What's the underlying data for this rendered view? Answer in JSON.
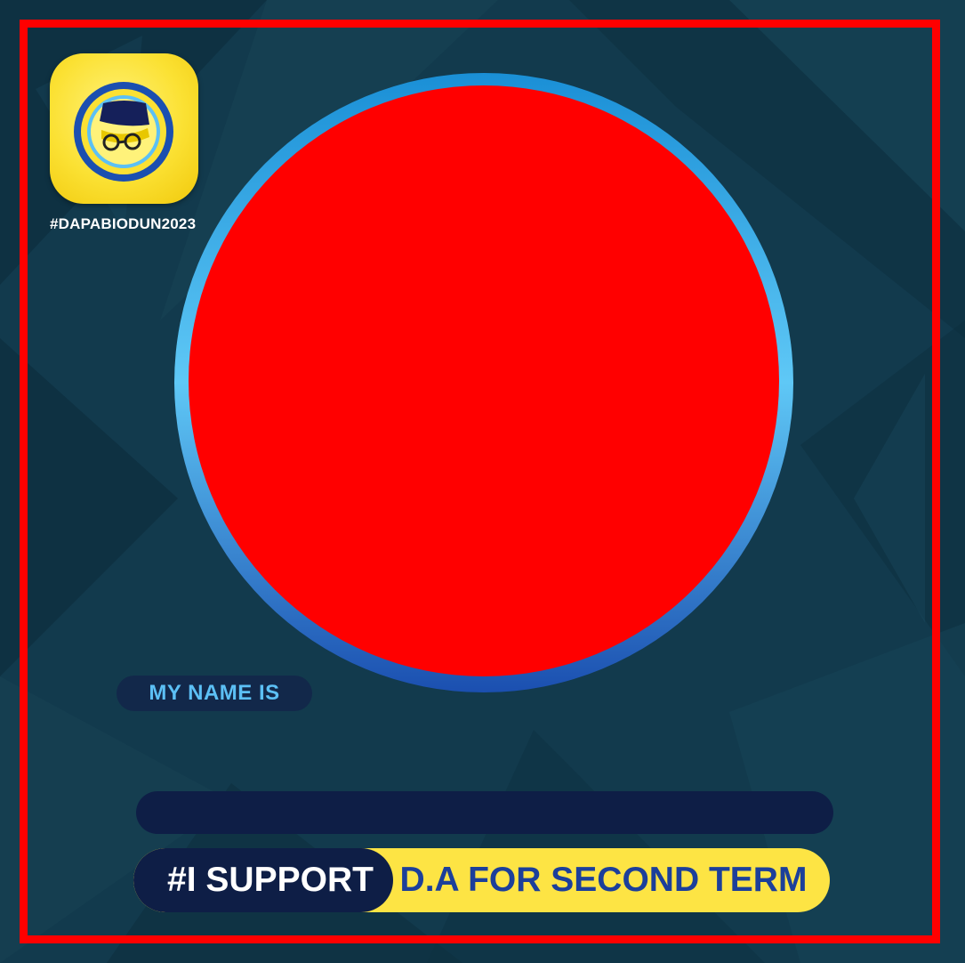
{
  "logo": {
    "hashtag": "#DAPABIODUN2023"
  },
  "name_section": {
    "label": "MY NAME IS",
    "value": ""
  },
  "support_bar": {
    "prefix": "#I SUPPORT",
    "message": "D.A FOR SECOND TERM"
  },
  "colors": {
    "border": "#ff0000",
    "photo_placeholder": "#ff0000",
    "background": "#123a4d",
    "navy": "#0e1e46",
    "yellow": "#fde444",
    "blue_text": "#1c3f9a",
    "light_blue_text": "#5cc0f5"
  }
}
